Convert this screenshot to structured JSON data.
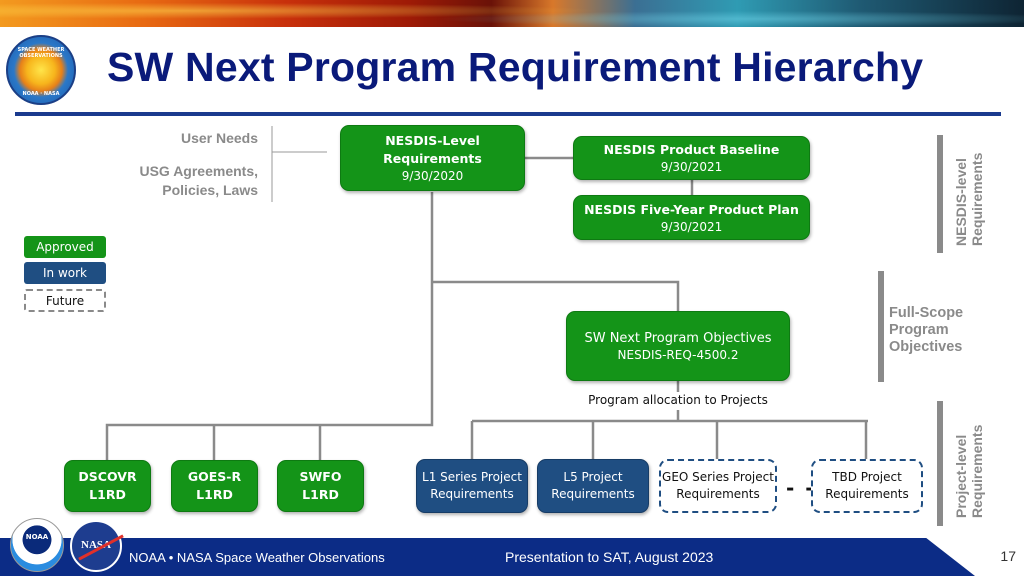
{
  "slide": {
    "title": "SW Next Program Requirement Hierarchy",
    "page_number": "17"
  },
  "logo": {
    "top_text": "SPACE WEATHER OBSERVATIONS",
    "bottom_text": "NOAA · NASA"
  },
  "inputs": {
    "user_needs": "User Needs",
    "usg_line1": "USG Agreements,",
    "usg_line2": "Policies, Laws"
  },
  "legend": {
    "approved": "Approved",
    "in_work": "In work",
    "future": "Future"
  },
  "colors": {
    "approved": "#149418",
    "in_work": "#1f4e82",
    "future_border": "#1f4e82",
    "title": "#0a1a7a",
    "footer": "#0c2c86",
    "label_gray": "#8a8a8a"
  },
  "nodes": {
    "nesdis_level": {
      "line1": "NESDIS-Level",
      "line2": "Requirements",
      "date": "9/30/2020",
      "status": "approved"
    },
    "product_baseline": {
      "title": "NESDIS Product Baseline",
      "date": "9/30/2021",
      "status": "approved"
    },
    "five_year_plan": {
      "title": "NESDIS Five-Year Product Plan",
      "date": "9/30/2021",
      "status": "approved"
    },
    "program_objectives": {
      "title": "SW Next Program Objectives",
      "ref": "NESDIS-REQ-4500.2",
      "status": "approved"
    },
    "dscovr": {
      "line1": "DSCOVR",
      "line2": "L1RD",
      "status": "approved"
    },
    "goes_r": {
      "line1": "GOES-R",
      "line2": "L1RD",
      "status": "approved"
    },
    "swfo": {
      "line1": "SWFO",
      "line2": "L1RD",
      "status": "approved"
    },
    "l1_series": {
      "line1": "L1 Series Project",
      "line2": "Requirements",
      "status": "in work"
    },
    "l5_project": {
      "line1": "L5 Project",
      "line2": "Requirements",
      "status": "in work"
    },
    "geo_series": {
      "line1": "GEO Series Project",
      "line2": "Requirements",
      "status": "future"
    },
    "tbd_project": {
      "line1": "TBD Project",
      "line2": "Requirements",
      "status": "future"
    }
  },
  "allocation_label": "Program allocation to Projects",
  "ellipsis_connector": "- -",
  "tiers": {
    "nesdis_line1": "NESDIS-level",
    "nesdis_line2": "Requirements",
    "full_scope_line1": "Full-Scope",
    "full_scope_line2": "Program",
    "full_scope_line3": "Objectives",
    "project_line1": "Project-level",
    "project_line2": "Requirements"
  },
  "footer": {
    "org": "NOAA • NASA Space Weather Observations",
    "presentation": "Presentation to SAT, August 2023",
    "noaa_logo_text": "NOAA",
    "nasa_logo_text": "NASA"
  }
}
